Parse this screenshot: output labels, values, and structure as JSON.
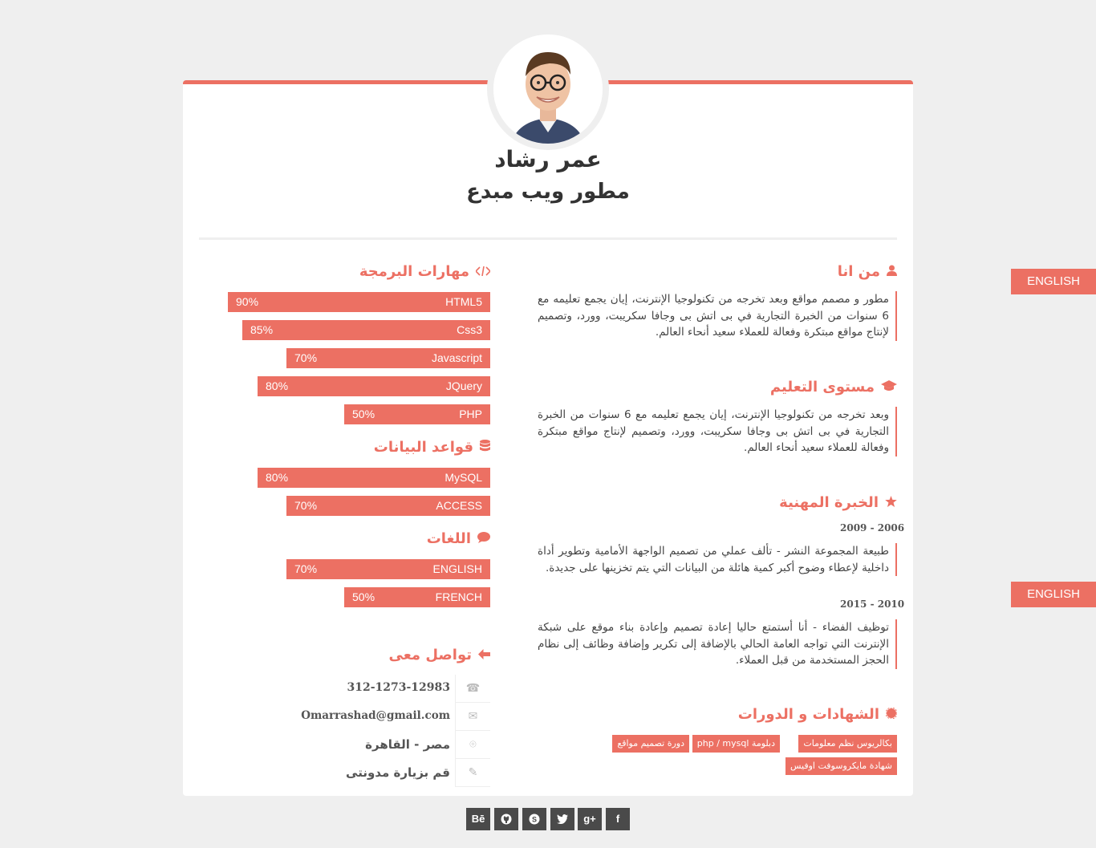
{
  "profile": {
    "name": "عمر رشاد",
    "job_title": "مطور ويب مبدع"
  },
  "about": {
    "title": "من انا",
    "text": "مطور و مصمم مواقع وبعد تخرجه من تكنولوجيا الإنترنت، إيان يجمع تعليمه مع 6 سنوات من الخبرة التجارية في بى اتش بى وجافا سكريبت، وورد، وتصميم لإنتاج مواقع مبتكرة وفعالة للعملاء سعيد أنحاء العالم."
  },
  "education": {
    "title": "مستوى التعليم",
    "text": "وبعد تخرجه من تكنولوجيا الإنترنت، إيان يجمع تعليمه مع 6 سنوات من الخبرة التجارية في بى اتش بى وجافا سكريبت، وورد، وتصميم لإنتاج مواقع مبتكرة وفعالة للعملاء سعيد أنحاء العالم."
  },
  "experience": {
    "title": "الخبرة المهنية",
    "items": [
      {
        "date": "2009 - 2006",
        "text": "طبيعة المجموعة النشر - تألف عملي من تصميم الواجهة الأمامية وتطوير أداة داخلية لإعطاء وضوح أكبر كمية هائلة من البيانات التي يتم تخزينها على جديدة."
      },
      {
        "date": "2015 - 2010",
        "text": "توظيف الفضاء - أنا أستمتع حاليا إعادة تصميم وإعادة بناء موقع على شبكة الإنترنت التي تواجه العامة الحالي بالإضافة إلى تكرير وإضافة وظائف إلى نظام الحجز المستخدمة من قبل العملاء."
      }
    ]
  },
  "certificates": {
    "title": "الشهادات و الدورات",
    "tags": [
      "بكالريوس نظم معلومات",
      "دبلومة php / mysql",
      "دورة تصميم مواقع",
      "شهادة مايكروسوفت اوفيس"
    ]
  },
  "programming": {
    "title": "مهارات البرمجة",
    "skills": [
      {
        "label": "HTML5",
        "percent_text": "90%",
        "value": 90
      },
      {
        "label": "Css3",
        "percent_text": "85%",
        "value": 85
      },
      {
        "label": "Javascript",
        "percent_text": "70%",
        "value": 70
      },
      {
        "label": "JQuery",
        "percent_text": "80%",
        "value": 80
      },
      {
        "label": "PHP",
        "percent_text": "50%",
        "value": 50
      }
    ]
  },
  "databases": {
    "title": "قواعد البيانات",
    "skills": [
      {
        "label": "MySQL",
        "percent_text": "80%",
        "value": 80
      },
      {
        "label": "ACCESS",
        "percent_text": "70%",
        "value": 70
      }
    ]
  },
  "languages": {
    "title": "اللغات",
    "skills": [
      {
        "label": "ENGLISH",
        "percent_text": "70%",
        "value": 70
      },
      {
        "label": "FRENCH",
        "percent_text": "50%",
        "value": 50
      }
    ]
  },
  "contact": {
    "title": "تواصل معى",
    "phone": "312-1273-12983",
    "email": "Omarrashad@gmail.com",
    "location": "مصر - القاهرة",
    "blog": "قم بزيارة مدونتى"
  },
  "language_buttons": [
    "ENGLISH",
    "ENGLISH"
  ],
  "social": [
    "facebook-icon",
    "google-plus-icon",
    "twitter-icon",
    "skype-icon",
    "github-icon",
    "behance-icon"
  ],
  "colors": {
    "accent": "#ec7063",
    "background": "#efefef",
    "social_bg": "#4a4a4a"
  }
}
